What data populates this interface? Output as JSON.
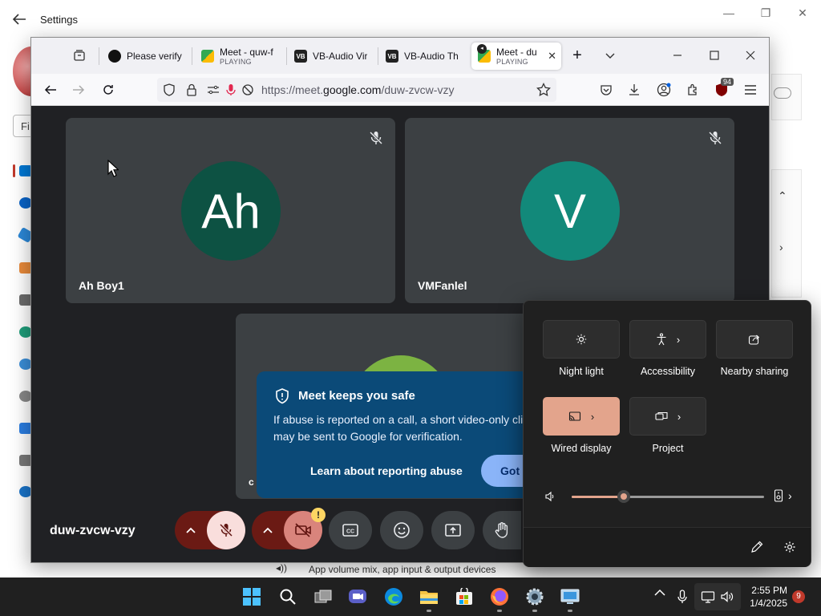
{
  "settings": {
    "title": "Settings",
    "find_placeholder": "Fi",
    "footer_text": "App volume mix, app input & output devices"
  },
  "browser": {
    "tabs": [
      {
        "title": "Please verify"
      },
      {
        "title": "Meet - quw-f",
        "status": "PLAYING"
      },
      {
        "title": "VB-Audio Vir"
      },
      {
        "title": "VB-Audio Th"
      },
      {
        "title": "Meet - du",
        "status": "PLAYING"
      }
    ],
    "url_prefix": "https://meet.",
    "url_host": "google.com",
    "url_path": "/duw-zvcw-vzy",
    "extension_badge": "94"
  },
  "meet": {
    "participants": [
      {
        "initials": "Ah",
        "name": "Ah Boy1",
        "avatar_color": "#0d5243"
      },
      {
        "initials": "V",
        "name": "VMFanlel",
        "avatar_color": "#12897a"
      }
    ],
    "third_tile_partial_initial": "c",
    "safety_card": {
      "title": "Meet keeps you safe",
      "body": "If abuse is reported on a call, a short video-only cli may be sent to Google for verification.",
      "learn_link": "Learn about reporting abuse",
      "confirm_button": "Got i"
    },
    "meeting_code": "duw-zvcw-vzy",
    "camera_warning_badge": "!"
  },
  "quick_settings": {
    "buttons": [
      {
        "label": "Night light",
        "icon": "brightness-icon",
        "on": false,
        "has_arrow": false
      },
      {
        "label": "Accessibility",
        "icon": "accessibility-icon",
        "on": false,
        "has_arrow": true
      },
      {
        "label": "Nearby sharing",
        "icon": "share-icon",
        "on": false,
        "has_arrow": false
      },
      {
        "label": "Wired display",
        "icon": "cast-icon",
        "on": true,
        "has_arrow": true
      },
      {
        "label": "Project",
        "icon": "project-icon",
        "on": false,
        "has_arrow": true
      }
    ],
    "volume_level": 0.27
  },
  "taskbar": {
    "time": "2:55 PM",
    "date": "1/4/2025",
    "notifications": "9"
  },
  "colors": {
    "meet_bg": "#202124",
    "tile_bg": "#3c4043",
    "accent": "#e3a48c",
    "mute_red": "#f9dedc"
  }
}
